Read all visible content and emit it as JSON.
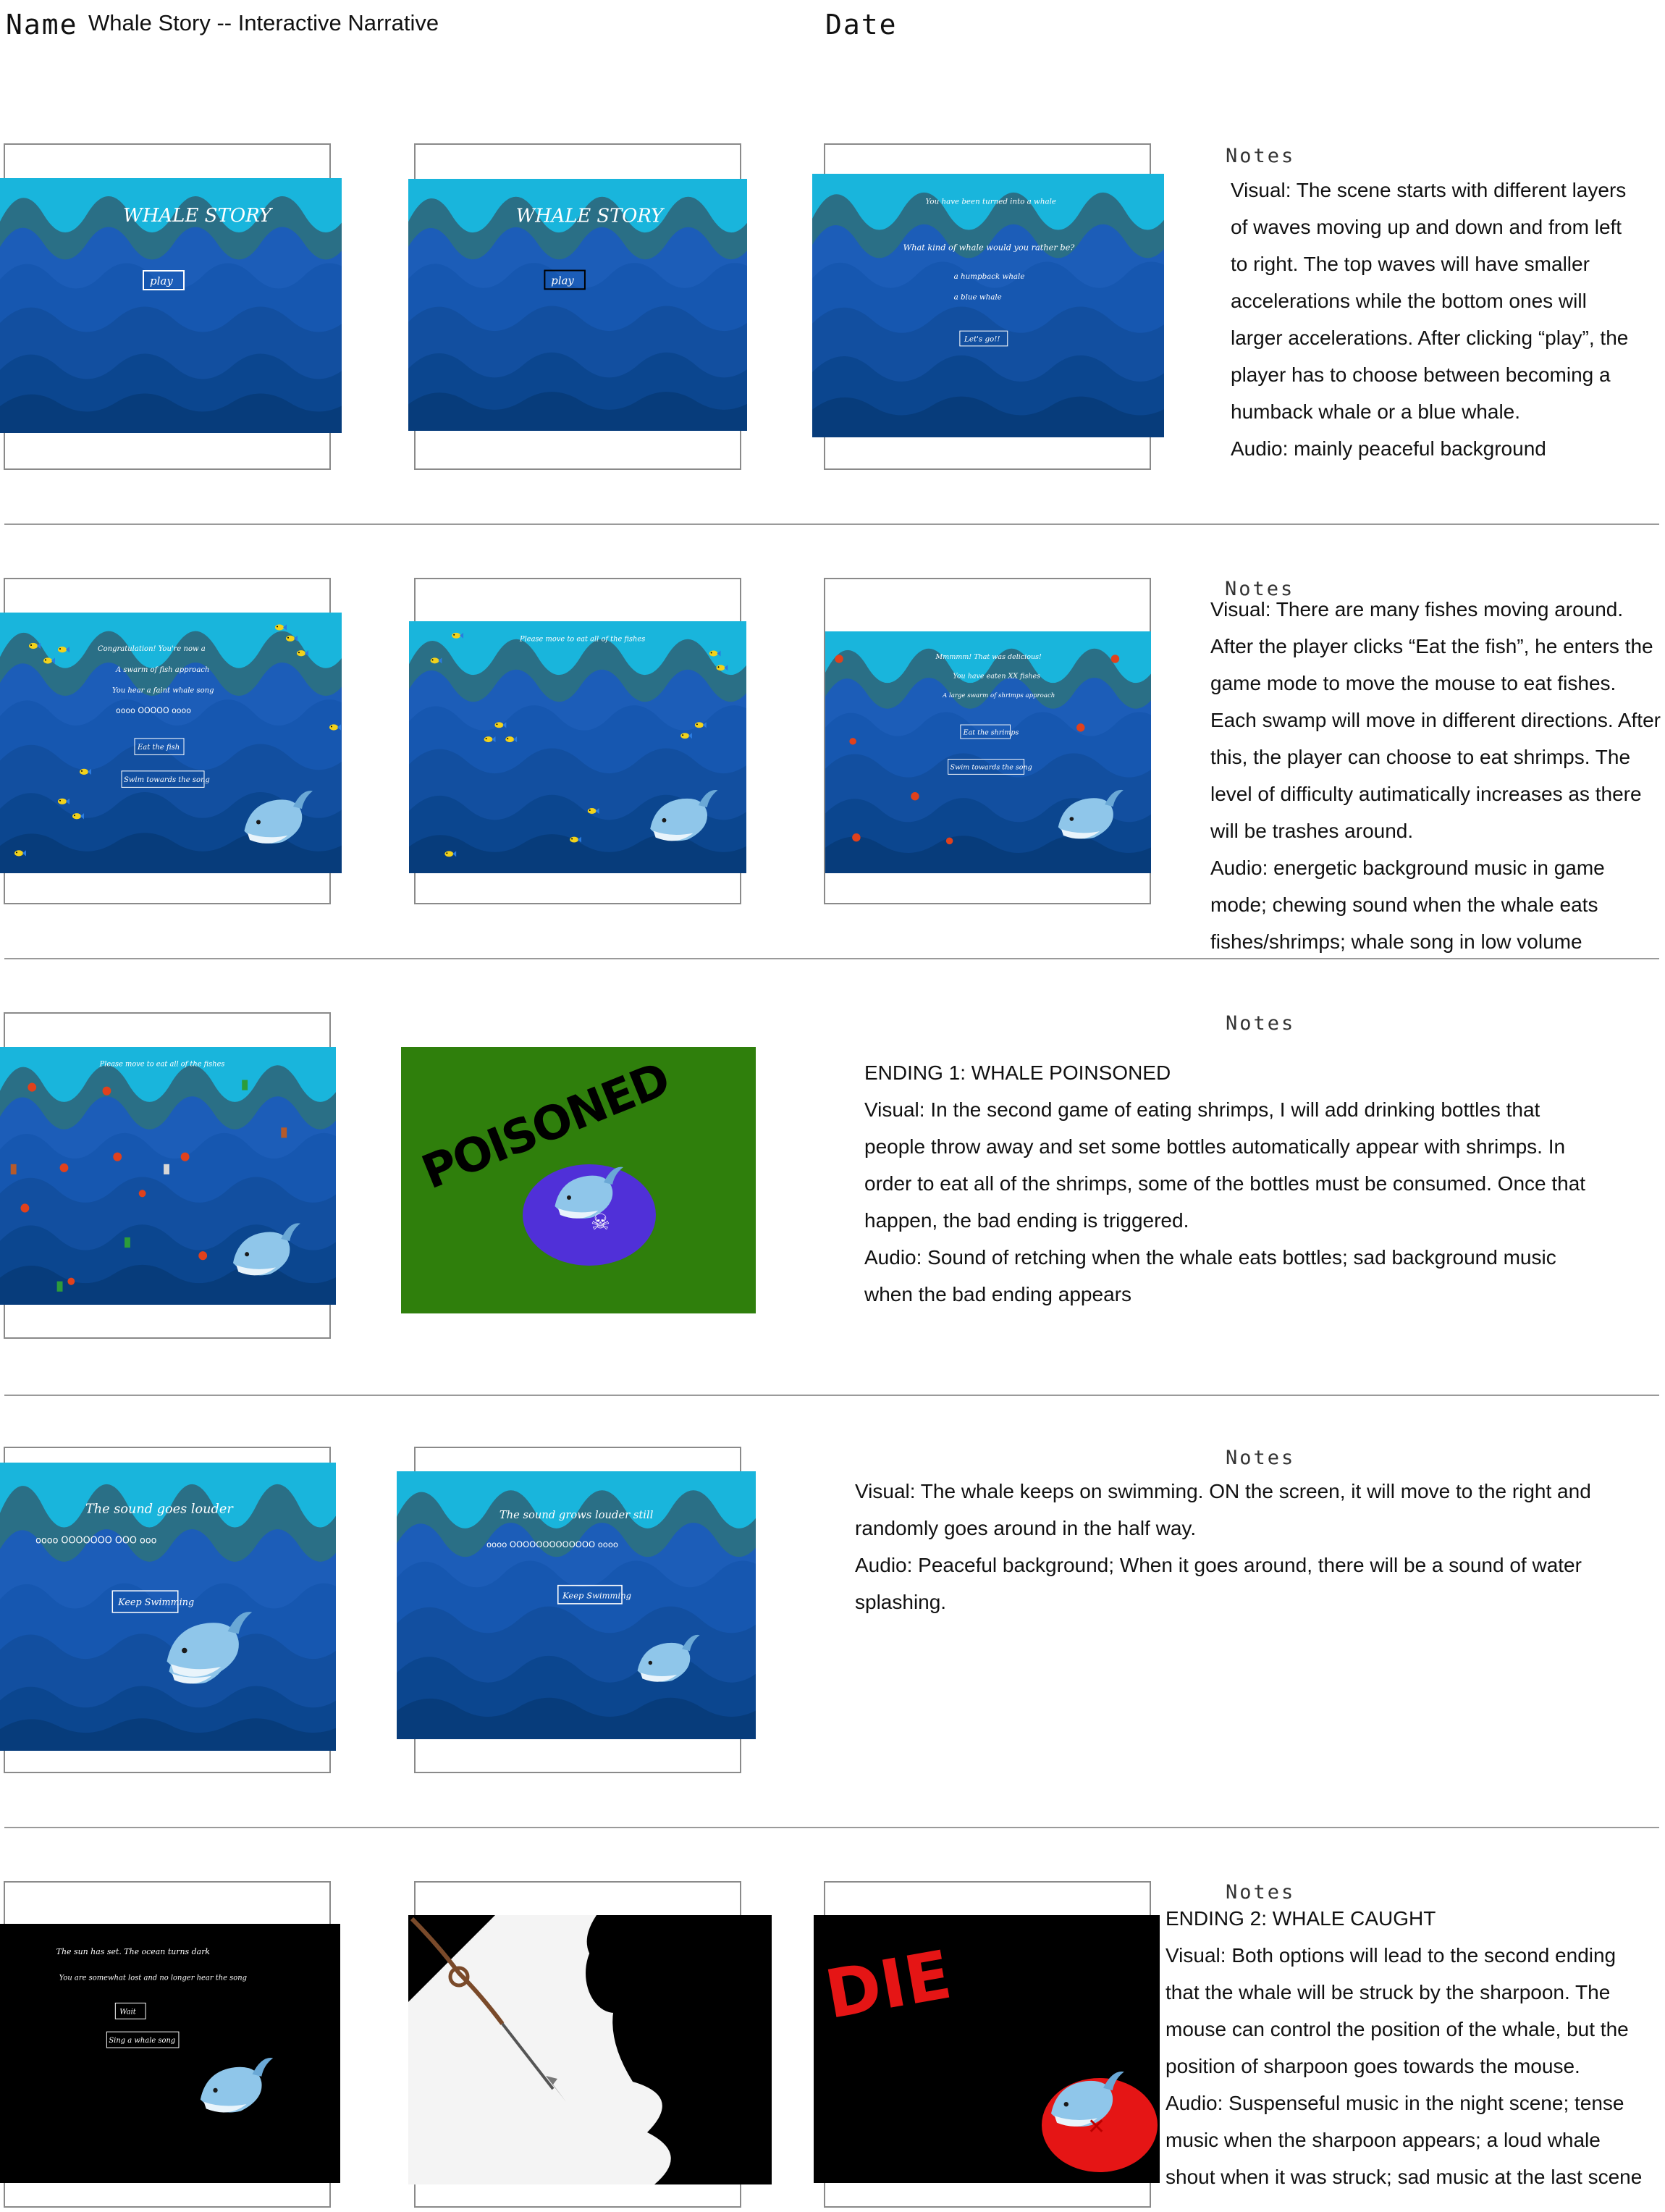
{
  "header": {
    "name_label": "Name",
    "title": "Whale Story -- Interactive Narrative",
    "date_label": "Date"
  },
  "notes_label": "Notes",
  "rows": [
    {
      "notes": [
        "Visual: The scene starts with different layers",
        "of waves moving up and down and from left",
        "to right. The top waves will have smaller",
        "accelerations while the bottom ones will",
        "larger accelerations. After clicking “play”, the",
        "player has to choose between becoming a",
        "humback whale or a blue whale.",
        "Audio: mainly peaceful background"
      ]
    },
    {
      "notes": [
        "Visual: There are many fishes moving around.",
        "After the player clicks “Eat the fish”, he enters the",
        "game mode to move the mouse to eat fishes.",
        "Each swamp will move in different directions. After",
        "this, the player can choose to eat shrimps. The",
        "level of difficulty autimatically increases as there",
        "will be trashes around.",
        "Audio: energetic background music in game",
        "mode; chewing sound when the whale eats",
        "fishes/shrimps; whale song in low volume"
      ]
    },
    {
      "notes": [
        "ENDING 1: WHALE POINSONED",
        "Visual: In the second game of eating shrimps, I will add drinking bottles that",
        "people throw away and set some bottles automatically appear with shrimps. In",
        "order to eat all of the shrimps, some of the bottles must be consumed. Once that",
        "happen, the bad ending is triggered.",
        "Audio: Sound of retching when the whale eats bottles; sad background music",
        "when the bad ending appears"
      ]
    },
    {
      "notes": [
        "Visual: The whale keeps on swimming. ON the screen, it will move to the right and",
        "randomly goes around in the half way.",
        "Audio: Peaceful background; When it goes around, there will be a sound of water",
        "splashing."
      ]
    },
    {
      "notes": [
        "ENDING 2: WHALE CAUGHT",
        "Visual: Both options will lead to the second ending",
        "that the whale will be struck by the sharpoon. The",
        "mouse can control the position of the whale, but the",
        "position of sharpoon goes towards the mouse.",
        "Audio: Suspenseful music in the night scene; tense",
        "music when the sharpoon appears; a loud whale",
        "shout when it was struck; sad music at the last scene"
      ]
    }
  ],
  "screens": {
    "title": "WHALE STORY",
    "play": "play",
    "choose_1": "You have been turned into a whale",
    "choose_2": "What kind of whale would you rather be?",
    "choose_opt1": "a humpback whale",
    "choose_opt2": "a blue whale",
    "choose_go": "Let's go!!",
    "fish_1": "Congratulation! You're now a",
    "fish_2": "A swarm of fish approach",
    "fish_3": "You hear a faint whale song",
    "fish_dots": "oooo OOOOO oooo",
    "eat_fish": "Eat the fish",
    "swim_song": "Swim towards the song",
    "eat_all_fishes": "Please move to eat all of the fishes",
    "shrimp_1": "Mmmmm! That was delicious!",
    "shrimp_2": "You have eaten XX fishes",
    "shrimp_3": "A large swarm of shrimps approach",
    "eat_shrimps": "Eat the shrimps",
    "poisoned": "POISONED",
    "louder": "The sound goes louder",
    "louder_dots": "oooo OOOOOOO OOO ooo",
    "keep_swimming": "Keep Swimming",
    "louder_still": "The sound grows louder still",
    "louder_still_dots": "oooo OOOOOOOOOOOOO oooo",
    "night_1": "The sun has set. The ocean turns dark",
    "night_2": "You are somewhat lost and no longer hear the song",
    "wait": "Wait",
    "sing": "Sing a whale song",
    "die": "DIE"
  },
  "colors": {
    "sky": "#19b5dc",
    "wave_mid": "#2a6f86",
    "deep": "#0f4aa6",
    "bottom": "#073c7b",
    "night": "#000000",
    "poison_bg": "#2f7f0c",
    "die_red": "#e51515"
  }
}
